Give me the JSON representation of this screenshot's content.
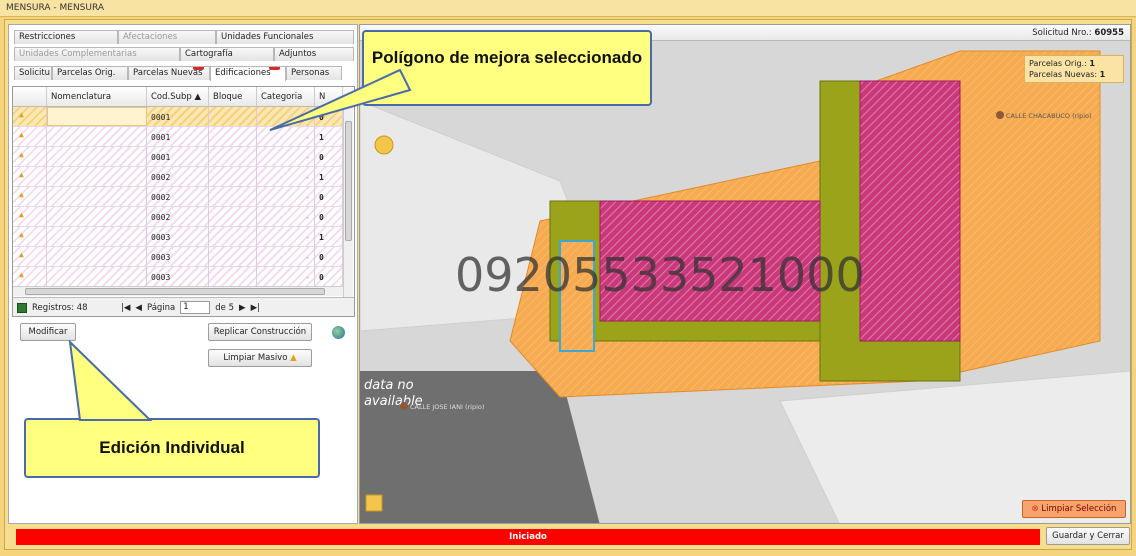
{
  "window": {
    "title": "MENSURA  -  MENSURA"
  },
  "tabs": {
    "row1": [
      "Restricciones",
      "Afectaciones",
      "Unidades Funcionales"
    ],
    "row2": [
      "Unidades Complementarias",
      "Cartografía",
      "Adjuntos"
    ],
    "row3": [
      "Solicitu",
      "Parcelas Orig.",
      "Parcelas Nuevas",
      "Edificaciones",
      "Personas"
    ],
    "badge_nuevas": "1",
    "badge_edif": "48"
  },
  "grid": {
    "columns": [
      "Nomenclatura",
      "Cod.Subp ▲",
      "Bloque",
      "Categoria",
      "N"
    ],
    "rows": [
      {
        "cod": "0001",
        "cat": "-",
        "n": "0"
      },
      {
        "cod": "0001",
        "cat": "-",
        "n": "1"
      },
      {
        "cod": "0001",
        "cat": "-",
        "n": "0"
      },
      {
        "cod": "0002",
        "cat": "-",
        "n": "1"
      },
      {
        "cod": "0002",
        "cat": "-",
        "n": "0"
      },
      {
        "cod": "0002",
        "cat": "-",
        "n": "0"
      },
      {
        "cod": "0003",
        "cat": "-",
        "n": "1"
      },
      {
        "cod": "0003",
        "cat": "-",
        "n": "0"
      },
      {
        "cod": "0003",
        "cat": "-",
        "n": "0"
      }
    ]
  },
  "pager": {
    "records": "Registros: 48",
    "page_label": "Página",
    "page_value": "1",
    "of": "de 5"
  },
  "buttons": {
    "modificar": "Modificar",
    "replicar": "Replicar Construcción",
    "limpiar_masivo": "Limpiar Masivo",
    "limpiar_seleccion": "Limpiar Selección",
    "guardar": "Guardar y Cerrar"
  },
  "map": {
    "solicitud_label": "Solicitud Nro.:",
    "solicitud_value": "60955",
    "parcelas_orig_label": "Parcelas Orig.:",
    "parcelas_orig_value": "1",
    "parcelas_nuevas_label": "Parcelas Nuevas:",
    "parcelas_nuevas_value": "1",
    "street1": "CALLE CHACABUCO (ripio)",
    "street2": "CALLE JOSE IANI (ripio)",
    "nomenclatura": "09205533521000",
    "nodata": "data no",
    "nodata2": "available"
  },
  "callouts": {
    "poligono": "Polígono de mejora seleccionado",
    "edicion": "Edición Individual"
  },
  "status": {
    "text": "Iniciado"
  },
  "colors": {
    "status": "#ff0000",
    "parcel": "#f7a94a",
    "building": "#9aa31a",
    "selected": "#d9328a"
  }
}
